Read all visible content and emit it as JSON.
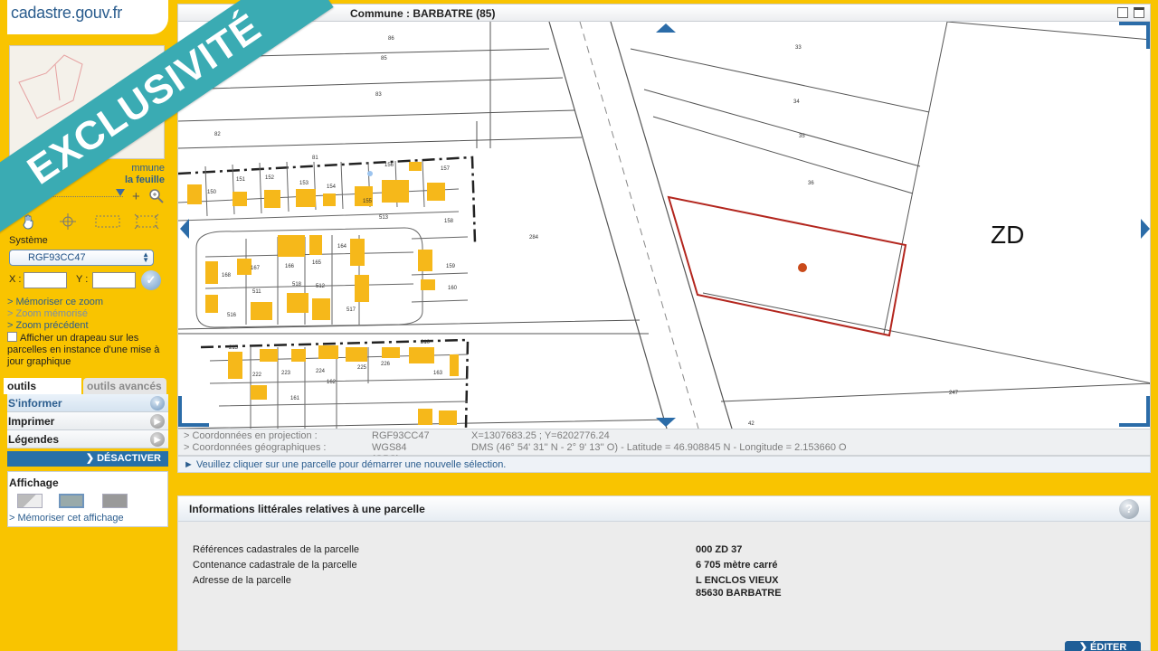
{
  "site": {
    "logo_text": "cadastre.gouv.fr"
  },
  "topbar": {
    "title": "Commune : BARBATRE (85)"
  },
  "banner": {
    "text": "EXCLUSIVITÉ"
  },
  "sidebar": {
    "commune_link": "mmune",
    "feuille_link": "la feuille",
    "systeme_label": "Système",
    "systeme_value": "RGF93CC47",
    "x_label": "X :",
    "y_label": "Y :",
    "links": {
      "memoriser_zoom": "> Mémoriser ce zoom",
      "zoom_memorise": "> Zoom mémorisé",
      "zoom_precedent": "> Zoom précédent"
    },
    "flag_checkbox_label": "Afficher un drapeau sur les parcelles en instance d'une mise à jour graphique",
    "tabs": {
      "simple": "outils simples",
      "advanced": "outils avancés"
    },
    "menu": [
      {
        "label": "S'informer"
      },
      {
        "label": "Imprimer"
      },
      {
        "label": "Légendes"
      }
    ],
    "desactiver": "DÉSACTIVER",
    "affichage_title": "Affichage",
    "memoriser_affichage": "> Mémoriser cet affichage"
  },
  "map": {
    "section_label": "ZD",
    "parcels": [
      "86",
      "85",
      "83",
      "82",
      "81",
      "150",
      "151",
      "152",
      "153",
      "154",
      "155",
      "156",
      "157",
      "158",
      "159",
      "160",
      "161",
      "162",
      "163",
      "164",
      "165",
      "166",
      "167",
      "168",
      "210",
      "215",
      "222",
      "223",
      "224",
      "225",
      "226",
      "247",
      "284",
      "33",
      "34",
      "35",
      "36",
      "42",
      "511",
      "512",
      "513",
      "516",
      "517",
      "518"
    ]
  },
  "coords": {
    "projection_label": "> Coordonnées en projection :",
    "projection_system": "RGF93CC47",
    "projection_value": "X=1307683.25 ; Y=6202776.24",
    "geo_label": "> Coordonnées géographiques :",
    "geo_system": "WGS84 (GPS)",
    "geo_value": "DMS (46° 54' 31'' N - 2° 9' 13'' O) - Latitude = 46.908845 N - Longitude = 2.153660 O"
  },
  "status": {
    "message": "► Veuillez cliquer sur une parcelle pour démarrer une nouvelle sélection."
  },
  "info": {
    "title": "Informations littérales relatives à une parcelle",
    "rows": [
      {
        "label": "Références cadastrales de la parcelle",
        "value": "000 ZD 37"
      },
      {
        "label": "Contenance cadastrale de la parcelle",
        "value": "6 705 mètre carré"
      },
      {
        "label": "Adresse de la parcelle",
        "value": "L ENCLOS VIEUX",
        "value2": "85630 BARBATRE"
      }
    ],
    "editer": "ÉDITER"
  },
  "colors": {
    "accent_yellow": "#f9c400",
    "brand_blue": "#2b5d8e",
    "banner_teal": "#3aabb3",
    "selection_red": "#b3261e",
    "building_orange": "#f6b81a"
  }
}
